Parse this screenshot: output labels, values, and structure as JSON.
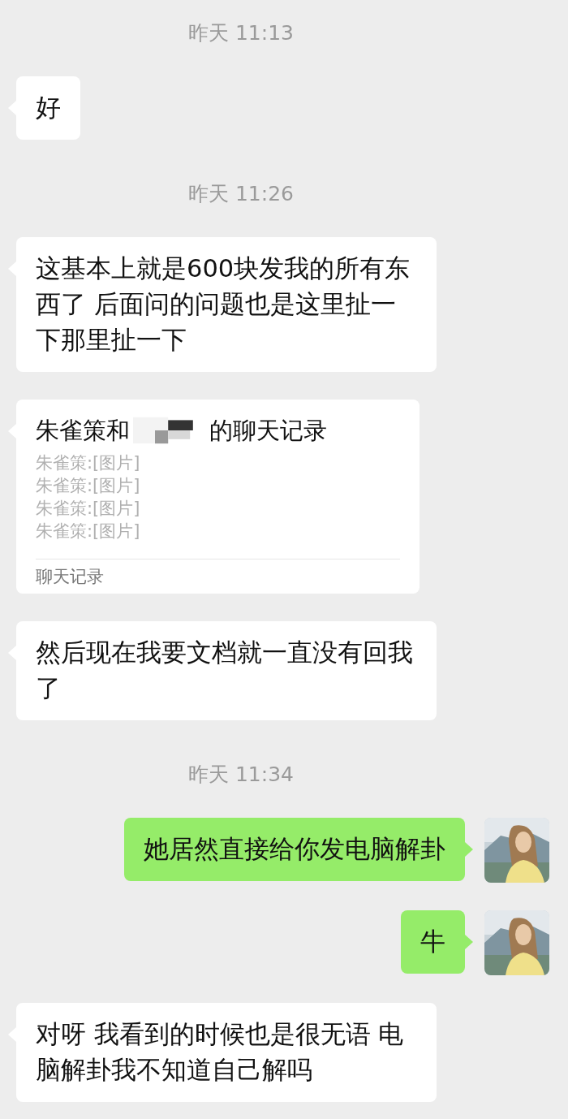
{
  "messages": [
    {
      "kind": "time",
      "text": "昨天 11:13"
    },
    {
      "kind": "text",
      "outgoing": false,
      "text": "好"
    },
    {
      "kind": "time",
      "text": "昨天 11:26"
    },
    {
      "kind": "text",
      "outgoing": false,
      "text": "这基本上就是600块发我的所有东西了 后面问的问题也是这里扯一下那里扯一下"
    },
    {
      "kind": "record",
      "outgoing": false,
      "title_start": "朱雀策和",
      "title_end": "的聊天记录",
      "redacted": true,
      "lines": [
        "朱雀策:[图片]",
        "朱雀策:[图片]",
        "朱雀策:[图片]",
        "朱雀策:[图片]"
      ],
      "footer": "聊天记录"
    },
    {
      "kind": "text",
      "outgoing": false,
      "text": "然后现在我要文档就一直没有回我了"
    },
    {
      "kind": "time",
      "text": "昨天 11:34"
    },
    {
      "kind": "text",
      "outgoing": true,
      "text": "她居然直接给你发电脑解卦"
    },
    {
      "kind": "text",
      "outgoing": true,
      "text": "牛"
    },
    {
      "kind": "text",
      "outgoing": false,
      "text": "对呀 我看到的时候也是很无语 电脑解卦我不知道自己解吗"
    }
  ]
}
